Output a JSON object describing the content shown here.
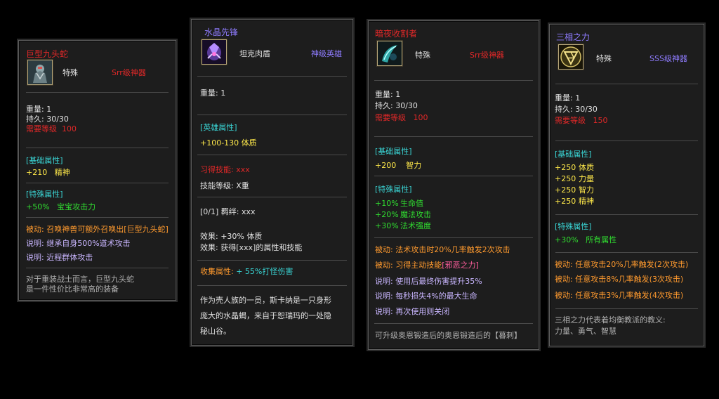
{
  "colors": {
    "background": "#000000",
    "card_bg": "#1d1d1d",
    "title_red": "#e02828",
    "title_purple": "#9a7dff",
    "attr_cyan": "#3ad6d6",
    "bonus_green": "#30dc30",
    "passive_orange": "#ff9a2e",
    "note_lilac": "#c9b6ff"
  },
  "card1": {
    "title": "巨型九头蛇",
    "icon": "armored-warrior-icon",
    "type": "特殊",
    "grade": "Srr级神器",
    "weight": "重量: 1",
    "durability_label": "持久:",
    "durability_value": "30/30",
    "level_label": "需要等级",
    "level_value": "100",
    "base_header": "[基础属性]",
    "base_num": "+210",
    "base_attr": "精神",
    "special_header": "[特殊属性]",
    "special_num": "+50%",
    "special_attr": "宝宝攻击力",
    "passive": "被动: 召唤神兽可额外召唤出[巨型九头蛇]",
    "note1": "说明: 继承自身500%道术攻击",
    "note2": "说明: 近程群体攻击",
    "desc1": "对于重装战士而言，巨型九头蛇",
    "desc2": "是一件性价比非常高的装备"
  },
  "card2": {
    "title": "水晶先锋",
    "icon": "crystal-scorpion-icon",
    "type": "坦克肉盾",
    "grade": "神级英雄",
    "weight": "重量: 1",
    "hero_header": "[英雄属性]",
    "hero_num": "+100-130",
    "hero_attr": "体质",
    "skill_learn": "习得技能: xxx",
    "skill_level": "技能等级: X重",
    "bond": "[0/1] 羁绊: xxx",
    "effect1": "效果: +30% 体质",
    "effect2": "效果: 获得[xxx]的属性和技能",
    "collect_label": "收集属性:",
    "collect_value": "+ 55%打怪伤害",
    "desc1": "作为壳人族的一员，斯卡纳是一只身形",
    "desc2": "庞大的水晶蝎，来自于恕瑞玛的一处隐",
    "desc3": "秘山谷。"
  },
  "card3": {
    "title": "暗夜收割者",
    "icon": "dark-reaper-icon",
    "type": "特殊",
    "grade": "Srr级神器",
    "weight": "重量: 1",
    "durability": "持久: 30/30",
    "level_label": "需要等级",
    "level_value": "100",
    "base_header": "[基础属性]",
    "base_num": "+200",
    "base_attr": "智力",
    "special_header": "[特殊属性]",
    "special": [
      {
        "num": "+10%",
        "attr": "生命值"
      },
      {
        "num": "+20%",
        "attr": "魔法攻击"
      },
      {
        "num": "+30%",
        "attr": "法术强度"
      }
    ],
    "passive1": "被动: 法术攻击时20%几率触发2次攻击",
    "passive2_prefix": "被动: 习得主动技能",
    "passive2_skill": "[邪恶之力]",
    "note1": "说明: 使用后最终伤害提升35%",
    "note2": "说明: 每秒损失4%的最大生命",
    "note3": "说明: 再次使用则关闭",
    "footer": "可升级奥恩锻造后的奥恩锻造后的【暮刺】"
  },
  "card4": {
    "title": "三相之力",
    "icon": "triforce-emblem-icon",
    "type": "特殊",
    "grade": "SSS级神器",
    "weight": "重量: 1",
    "durability": "持久: 30/30",
    "level_label": "需要等级",
    "level_value": "150",
    "base_header": "[基础属性]",
    "base": [
      {
        "num": "+250",
        "attr": "体质"
      },
      {
        "num": "+250",
        "attr": "力量"
      },
      {
        "num": "+250",
        "attr": "智力"
      },
      {
        "num": "+250",
        "attr": "精神"
      }
    ],
    "special_header": "[特殊属性]",
    "special_num": "+30%",
    "special_attr": "所有属性",
    "passive1": "被动: 任意攻击20%几率触发(2次攻击)",
    "passive2": "被动: 任意攻击8%几率触发(3次攻击)",
    "passive3": "被动: 任意攻击3%几率触发(4次攻击)",
    "desc1": "三相之力代表着均衡教派的教义:",
    "desc2": "力量、勇气、智慧"
  }
}
